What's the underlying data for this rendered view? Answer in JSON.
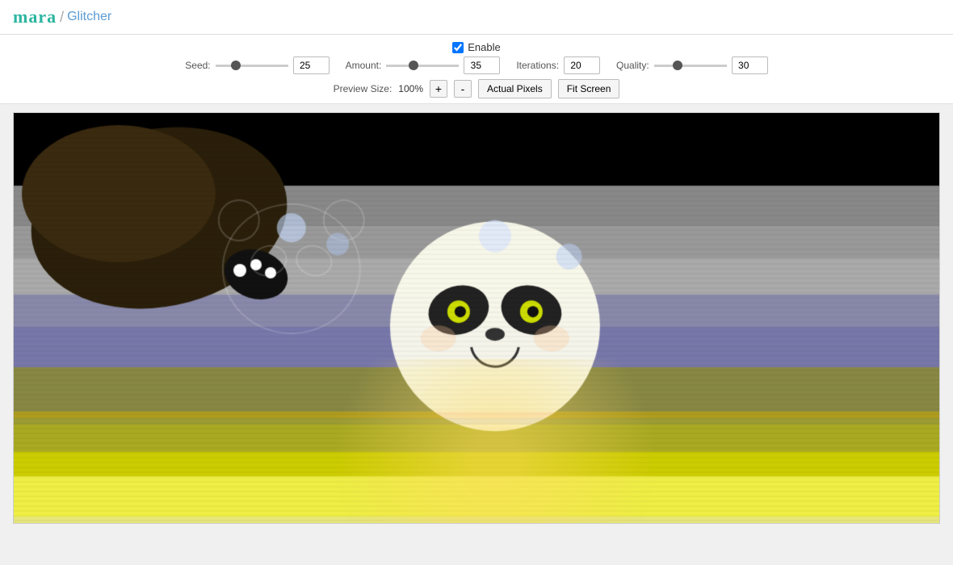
{
  "header": {
    "logo_mara": "mara",
    "logo_slash": "/",
    "logo_glitcher": "Glitcher"
  },
  "controls": {
    "enable_label": "Enable",
    "enable_checked": true,
    "seed_label": "Seed:",
    "seed_value": 25,
    "seed_min": 0,
    "seed_max": 100,
    "amount_label": "Amount:",
    "amount_value": 35,
    "amount_min": 0,
    "amount_max": 100,
    "iterations_label": "Iterations:",
    "iterations_value": 20,
    "quality_label": "Quality:",
    "quality_value": 30,
    "quality_min": 0,
    "quality_max": 100,
    "preview_size_label": "Preview Size:",
    "preview_pct": "100%",
    "btn_plus": "+",
    "btn_minus": "-",
    "btn_actual_pixels": "Actual Pixels",
    "btn_fit_screen": "Fit Screen"
  }
}
